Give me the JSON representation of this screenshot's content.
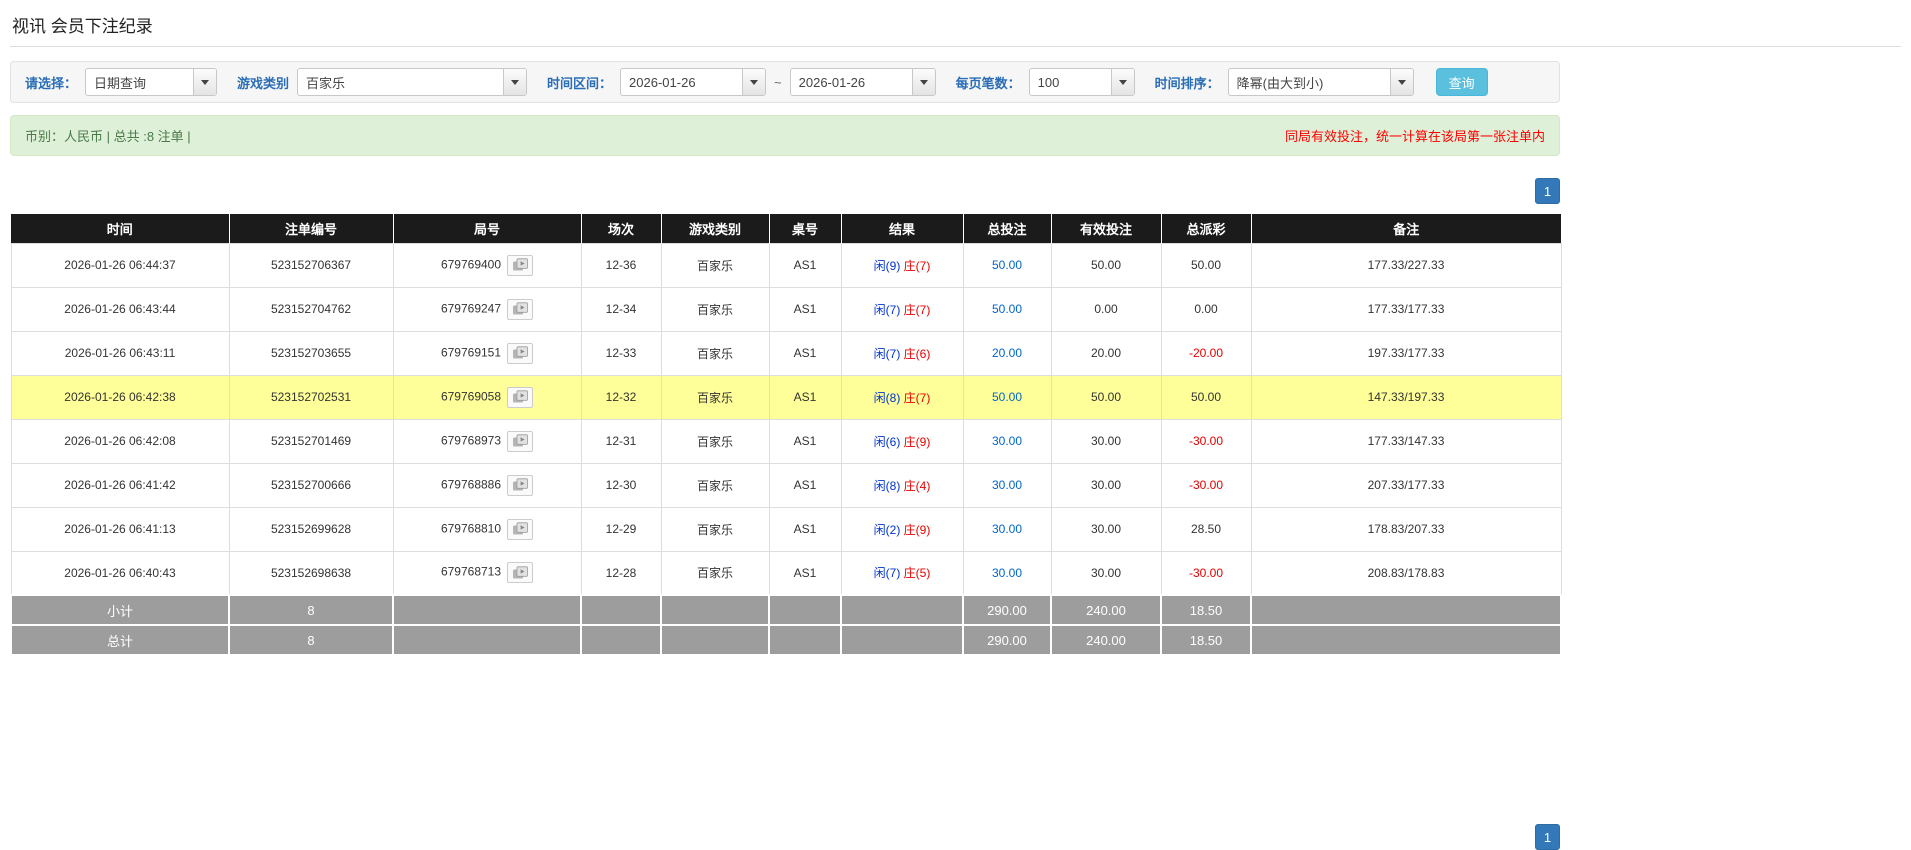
{
  "page": {
    "title": "视讯 会员下注纪录"
  },
  "filters": {
    "select": {
      "label": "请选择：",
      "value": "日期查询"
    },
    "game_type": {
      "label": "游戏类别",
      "value": "百家乐"
    },
    "time_range": {
      "label": "时间区间：",
      "from": "2026-01-26",
      "separator": "~",
      "to": "2026-01-26"
    },
    "page_size": {
      "label": "每页笔数：",
      "value": "100"
    },
    "sort": {
      "label": "时间排序：",
      "value": "降幂(由大到小)"
    },
    "search_button_label": "查询"
  },
  "summary": {
    "currency_info": "币别：人民币 | 总共 :8 注单 |",
    "notice": "同局有效投注，统一计算在该局第一张注单内"
  },
  "pagination": {
    "current_page": "1"
  },
  "table": {
    "headers": [
      "时间",
      "注单编号",
      "局号",
      "场次",
      "游戏类别",
      "桌号",
      "结果",
      "总投注",
      "有效投注",
      "总派彩",
      "备注"
    ],
    "rows": [
      {
        "time": "2026-01-26 06:44:37",
        "bet_id": "523152706367",
        "round_id": "679769400",
        "session": "12-36",
        "game_type": "百家乐",
        "table_id": "AS1",
        "result_player": "闲(9)",
        "result_banker": "庄(7)",
        "total_bet": "50.00",
        "valid_bet": "50.00",
        "payout": "50.00",
        "remark": "177.33/227.33",
        "highlighted": false
      },
      {
        "time": "2026-01-26 06:43:44",
        "bet_id": "523152704762",
        "round_id": "679769247",
        "session": "12-34",
        "game_type": "百家乐",
        "table_id": "AS1",
        "result_player": "闲(7)",
        "result_banker": "庄(7)",
        "total_bet": "50.00",
        "valid_bet": "0.00",
        "payout": "0.00",
        "remark": "177.33/177.33",
        "highlighted": false
      },
      {
        "time": "2026-01-26 06:43:11",
        "bet_id": "523152703655",
        "round_id": "679769151",
        "session": "12-33",
        "game_type": "百家乐",
        "table_id": "AS1",
        "result_player": "闲(7)",
        "result_banker": "庄(6)",
        "total_bet": "20.00",
        "valid_bet": "20.00",
        "payout": "-20.00",
        "remark": "197.33/177.33",
        "highlighted": false
      },
      {
        "time": "2026-01-26 06:42:38",
        "bet_id": "523152702531",
        "round_id": "679769058",
        "session": "12-32",
        "game_type": "百家乐",
        "table_id": "AS1",
        "result_player": "闲(8)",
        "result_banker": "庄(7)",
        "total_bet": "50.00",
        "valid_bet": "50.00",
        "payout": "50.00",
        "remark": "147.33/197.33",
        "highlighted": true
      },
      {
        "time": "2026-01-26 06:42:08",
        "bet_id": "523152701469",
        "round_id": "679768973",
        "session": "12-31",
        "game_type": "百家乐",
        "table_id": "AS1",
        "result_player": "闲(6)",
        "result_banker": "庄(9)",
        "total_bet": "30.00",
        "valid_bet": "30.00",
        "payout": "-30.00",
        "remark": "177.33/147.33",
        "highlighted": false
      },
      {
        "time": "2026-01-26 06:41:42",
        "bet_id": "523152700666",
        "round_id": "679768886",
        "session": "12-30",
        "game_type": "百家乐",
        "table_id": "AS1",
        "result_player": "闲(8)",
        "result_banker": "庄(4)",
        "total_bet": "30.00",
        "valid_bet": "30.00",
        "payout": "-30.00",
        "remark": "207.33/177.33",
        "highlighted": false
      },
      {
        "time": "2026-01-26 06:41:13",
        "bet_id": "523152699628",
        "round_id": "679768810",
        "session": "12-29",
        "game_type": "百家乐",
        "table_id": "AS1",
        "result_player": "闲(2)",
        "result_banker": "庄(9)",
        "total_bet": "30.00",
        "valid_bet": "30.00",
        "payout": "28.50",
        "remark": "178.83/207.33",
        "highlighted": false
      },
      {
        "time": "2026-01-26 06:40:43",
        "bet_id": "523152698638",
        "round_id": "679768713",
        "session": "12-28",
        "game_type": "百家乐",
        "table_id": "AS1",
        "result_player": "闲(7)",
        "result_banker": "庄(5)",
        "total_bet": "30.00",
        "valid_bet": "30.00",
        "payout": "-30.00",
        "remark": "208.83/178.83",
        "highlighted": false
      }
    ],
    "subtotal": {
      "label": "小计",
      "count": "8",
      "total_bet": "290.00",
      "valid_bet": "240.00",
      "payout": "18.50"
    },
    "grand_total": {
      "label": "总计",
      "count": "8",
      "total_bet": "290.00",
      "valid_bet": "240.00",
      "payout": "18.50"
    }
  },
  "icons": {
    "dropdown": "chevron-down-icon",
    "round_replay": "video-replay-icon"
  },
  "colors": {
    "filter_label": "#2a6db5",
    "search_button": "#5bc0de",
    "summary_bg": "#dff0d8",
    "summary_text": "#4a7a4a",
    "notice_red": "#ff0000",
    "table_header_bg": "#1b1b1b",
    "row_highlight": "#ffff99",
    "footer_bg": "#9d9d9d",
    "bet_link": "#0066cc",
    "player_blue": "#0033cc",
    "banker_red": "#e60000",
    "negative_red": "#e60000",
    "pagination_blue": "#3379b9"
  }
}
